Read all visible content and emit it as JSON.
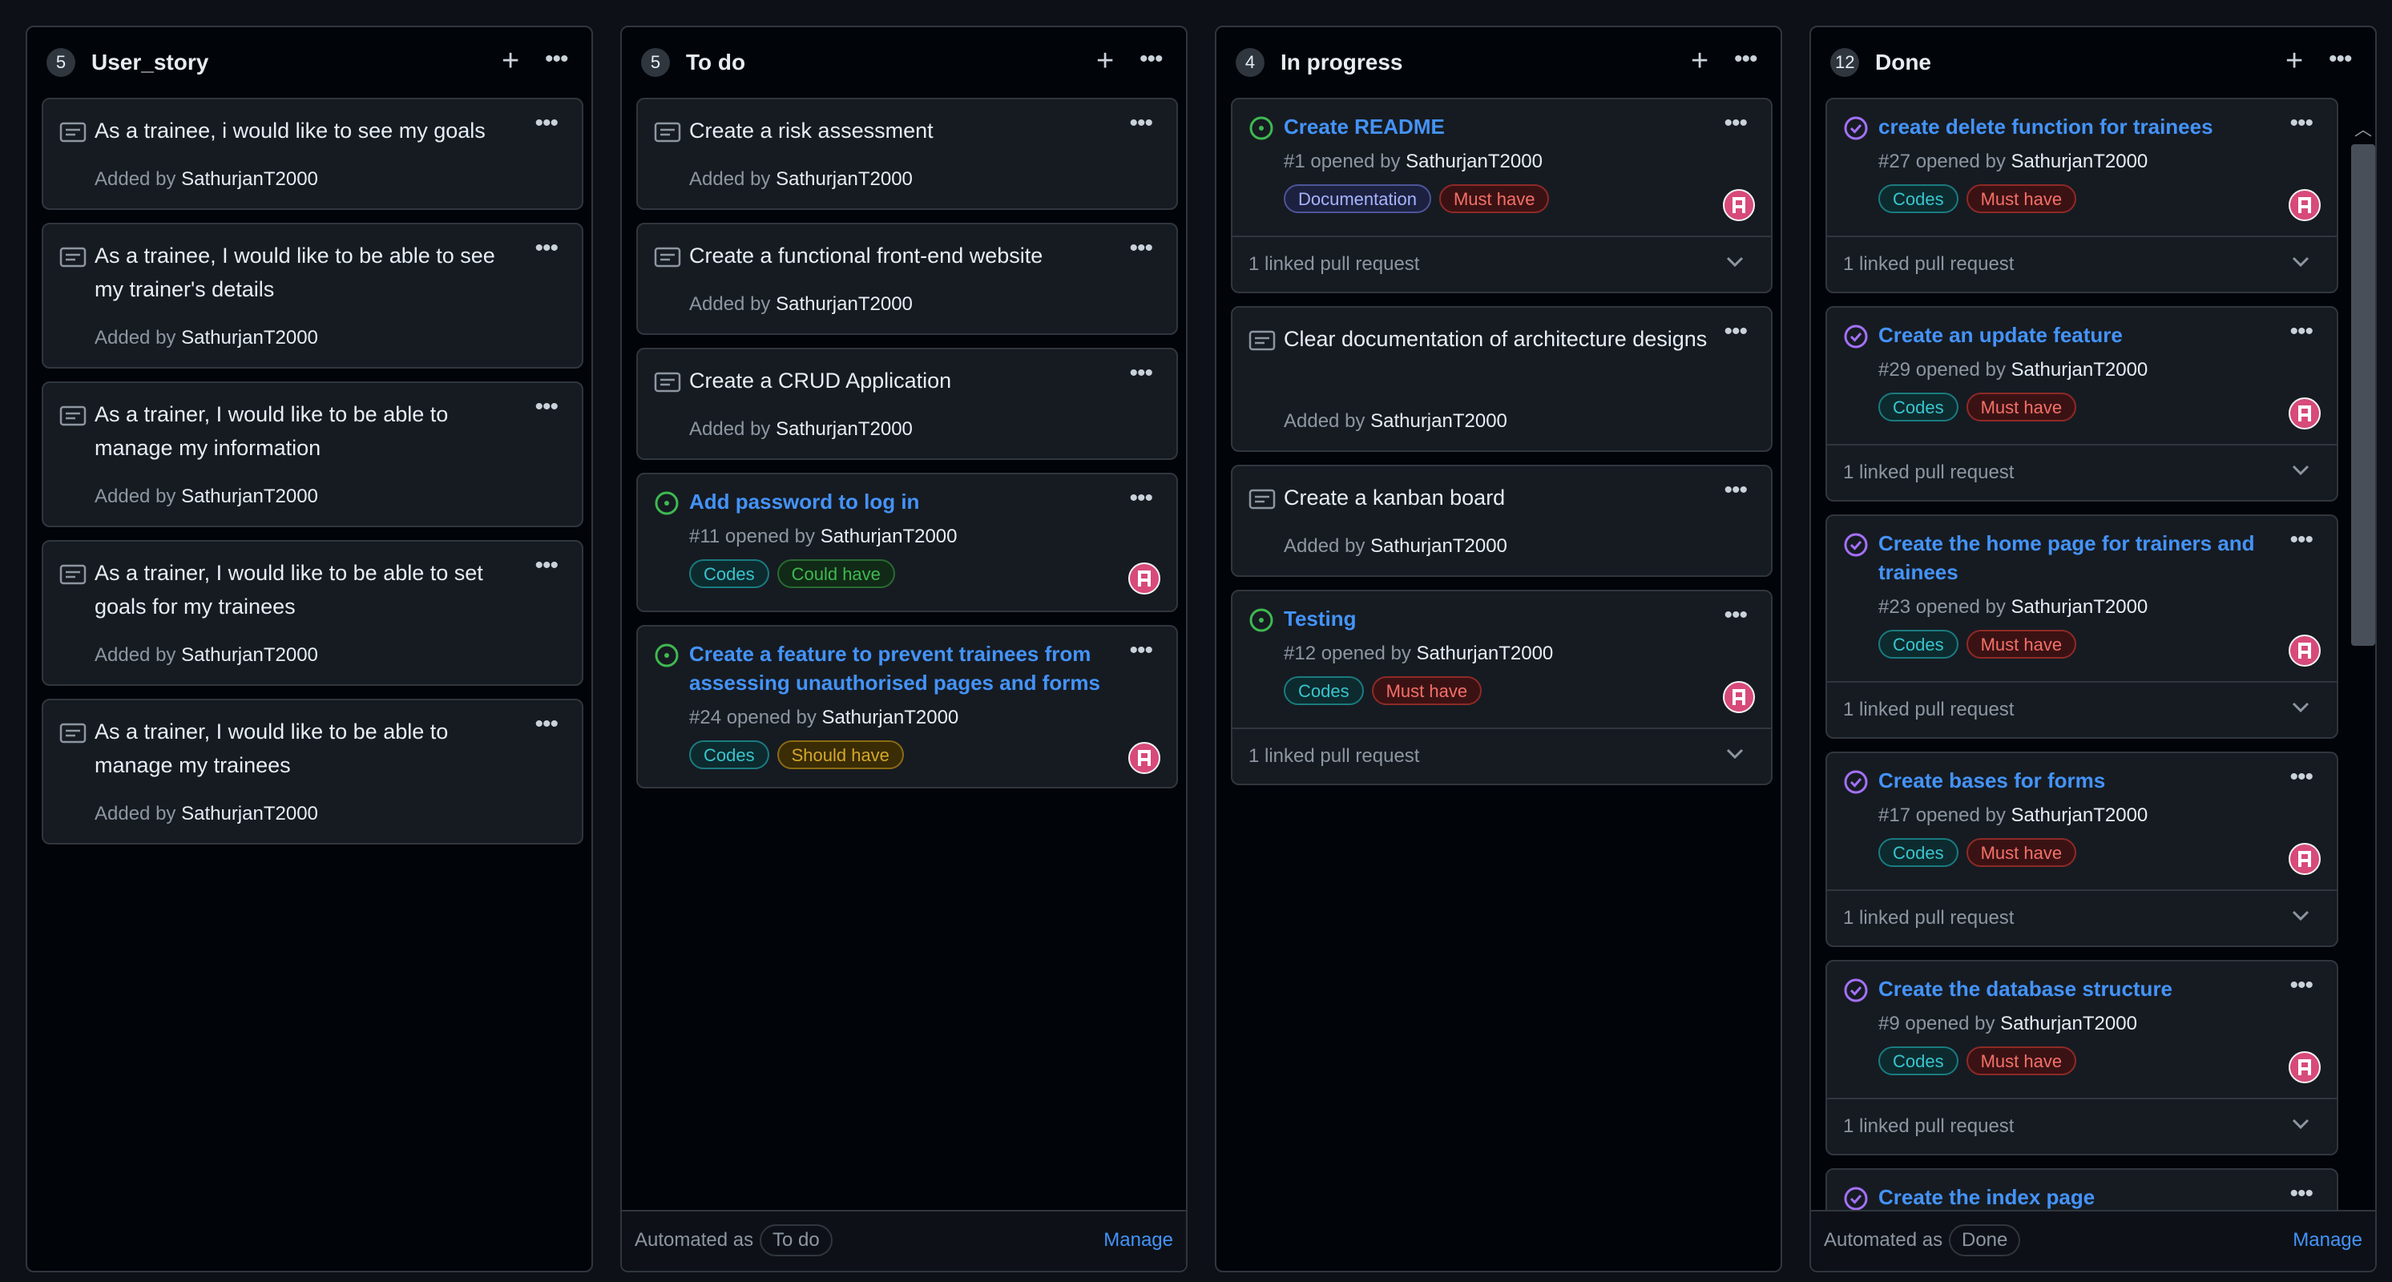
{
  "columns": [
    {
      "title": "User_story",
      "count": "5",
      "cards": [
        {
          "title": "As a trainee, i would like to see my goals",
          "added_by": "Added by",
          "author": "SathurjanT2000"
        },
        {
          "title": "As a trainee, I would like to be able to see my trainer's details",
          "added_by": "Added by",
          "author": "SathurjanT2000"
        },
        {
          "title": "As a trainer, I would like to be able to manage my information",
          "added_by": "Added by",
          "author": "SathurjanT2000"
        },
        {
          "title": "As a trainer, I would like to be able to set goals for my trainees",
          "added_by": "Added by",
          "author": "SathurjanT2000"
        },
        {
          "title": "As a trainer, I would like to be able to manage my trainees",
          "added_by": "Added by",
          "author": "SathurjanT2000"
        }
      ]
    },
    {
      "title": "To do",
      "count": "5",
      "automated_label": "Automated as",
      "automated_value": "To do",
      "manage": "Manage",
      "cards": [
        {
          "title": "Create a risk assessment",
          "added_by": "Added by",
          "author": "SathurjanT2000"
        },
        {
          "title": "Create a functional front-end website",
          "added_by": "Added by",
          "author": "SathurjanT2000"
        },
        {
          "title": "Create a CRUD Application",
          "added_by": "Added by",
          "author": "SathurjanT2000"
        },
        {
          "title": "Add password to log in",
          "meta": "#11 opened by",
          "author": "SathurjanT2000",
          "labels": [
            "Codes",
            "Could have"
          ]
        },
        {
          "title": "Create a feature to prevent trainees from assessing unauthorised pages and forms",
          "meta": "#24 opened by",
          "author": "SathurjanT2000",
          "labels": [
            "Codes",
            "Should have"
          ]
        }
      ]
    },
    {
      "title": "In progress",
      "count": "4",
      "cards": [
        {
          "title": "Create README",
          "meta": "#1 opened by",
          "author": "SathurjanT2000",
          "labels": [
            "Documentation",
            "Must have"
          ],
          "linked": "1 linked pull request"
        },
        {
          "title": "Clear documentation of architecture designs",
          "added_by": "Added by",
          "author": "SathurjanT2000"
        },
        {
          "title": "Create a kanban board",
          "added_by": "Added by",
          "author": "SathurjanT2000"
        },
        {
          "title": "Testing",
          "meta": "#12 opened by",
          "author": "SathurjanT2000",
          "labels": [
            "Codes",
            "Must have"
          ],
          "linked": "1 linked pull request"
        }
      ]
    },
    {
      "title": "Done",
      "count": "12",
      "automated_label": "Automated as",
      "automated_value": "Done",
      "manage": "Manage",
      "cards": [
        {
          "title": "create delete function for trainees",
          "meta": "#27 opened by",
          "author": "SathurjanT2000",
          "labels": [
            "Codes",
            "Must have"
          ],
          "linked": "1 linked pull request"
        },
        {
          "title": "Create an update feature",
          "meta": "#29 opened by",
          "author": "SathurjanT2000",
          "labels": [
            "Codes",
            "Must have"
          ],
          "linked": "1 linked pull request"
        },
        {
          "title": "Create the home page for trainers and trainees",
          "meta": "#23 opened by",
          "author": "SathurjanT2000",
          "labels": [
            "Codes",
            "Must have"
          ],
          "linked": "1 linked pull request"
        },
        {
          "title": "Create bases for forms",
          "meta": "#17 opened by",
          "author": "SathurjanT2000",
          "labels": [
            "Codes",
            "Must have"
          ],
          "linked": "1 linked pull request"
        },
        {
          "title": "Create the database structure",
          "meta": "#9 opened by",
          "author": "SathurjanT2000",
          "labels": [
            "Codes",
            "Must have"
          ],
          "linked": "1 linked pull request"
        },
        {
          "title": "Create the index page"
        }
      ]
    }
  ],
  "colors": {
    "open_issue": "#3fb950",
    "closed_issue": "#a371f7",
    "link": "#4493f8",
    "codes": "#39c5cf",
    "must_have": "#f47067",
    "could_have": "#3fb950",
    "should_have": "#d4a72c",
    "documentation": "#a5b4fc"
  },
  "icons": [
    "note-icon",
    "issue-opened-icon",
    "issue-closed-icon",
    "plus-icon",
    "kebab-horizontal-icon",
    "chevron-down-icon",
    "avatar"
  ]
}
